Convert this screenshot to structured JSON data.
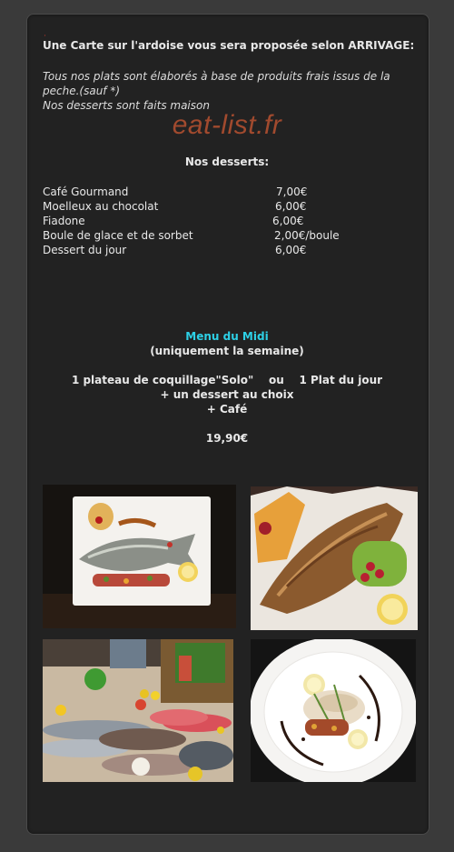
{
  "intro": {
    "marker": "·",
    "title": "Une Carte sur l'ardoise vous sera proposée selon ARRIVAGE:",
    "lines": [
      "Tous nos plats sont élaborés à base de produits frais issus de la",
      "peche.(sauf *)",
      "Nos desserts sont faits maison"
    ]
  },
  "watermark": "eat-list.fr",
  "desserts": {
    "title": "Nos desserts:",
    "items": [
      {
        "name": "Café Gourmand",
        "price": "7,00€"
      },
      {
        "name": "Moelleux au chocolat",
        "price": "6,00€"
      },
      {
        "name": "Fiadone",
        "price": "6,00€"
      },
      {
        "name": "Boule de glace et de sorbet",
        "price": "2,00€/boule"
      },
      {
        "name": "Dessert du jour",
        "price": "6,00€"
      }
    ]
  },
  "midi": {
    "title": "Menu du Midi",
    "subtitle": "(uniquement la semaine)",
    "lines": [
      "1 plateau de coquillage\"Solo\"    ou    1 Plat du jour",
      "+ un dessert au choix",
      "+ Café"
    ],
    "price": "19,90€"
  },
  "colors": {
    "background": "#3a3a3a",
    "panel": "#222222",
    "accent": "#2dd0e6",
    "watermark": "#a14a2e"
  },
  "photos": [
    "grilled-fish-plate",
    "fish-fillet-plate",
    "fresh-fish-display",
    "fish-dish-plate"
  ]
}
